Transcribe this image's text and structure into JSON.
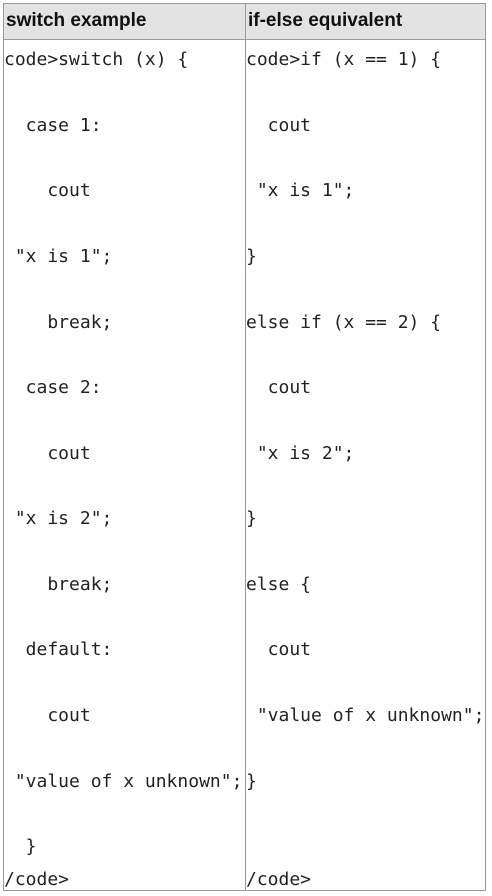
{
  "table": {
    "headers": [
      "switch example",
      "if-else equivalent"
    ],
    "left_lines": [
      "code>switch (x) {",
      "  case 1:",
      "    cout",
      " \"x is 1\";",
      "    break;",
      "  case 2:",
      "    cout",
      " \"x is 2\";",
      "    break;",
      "  default:",
      "    cout",
      " \"value of x unknown\";",
      "  }",
      "/code>"
    ],
    "right_lines": [
      "code>if (x == 1) {",
      "  cout",
      " \"x is 1\";",
      "}",
      "else if (x == 2) {",
      "  cout",
      " \"x is 2\";",
      "}",
      "else {",
      "  cout",
      " \"value of x unknown\";",
      "}",
      "/code>"
    ]
  }
}
